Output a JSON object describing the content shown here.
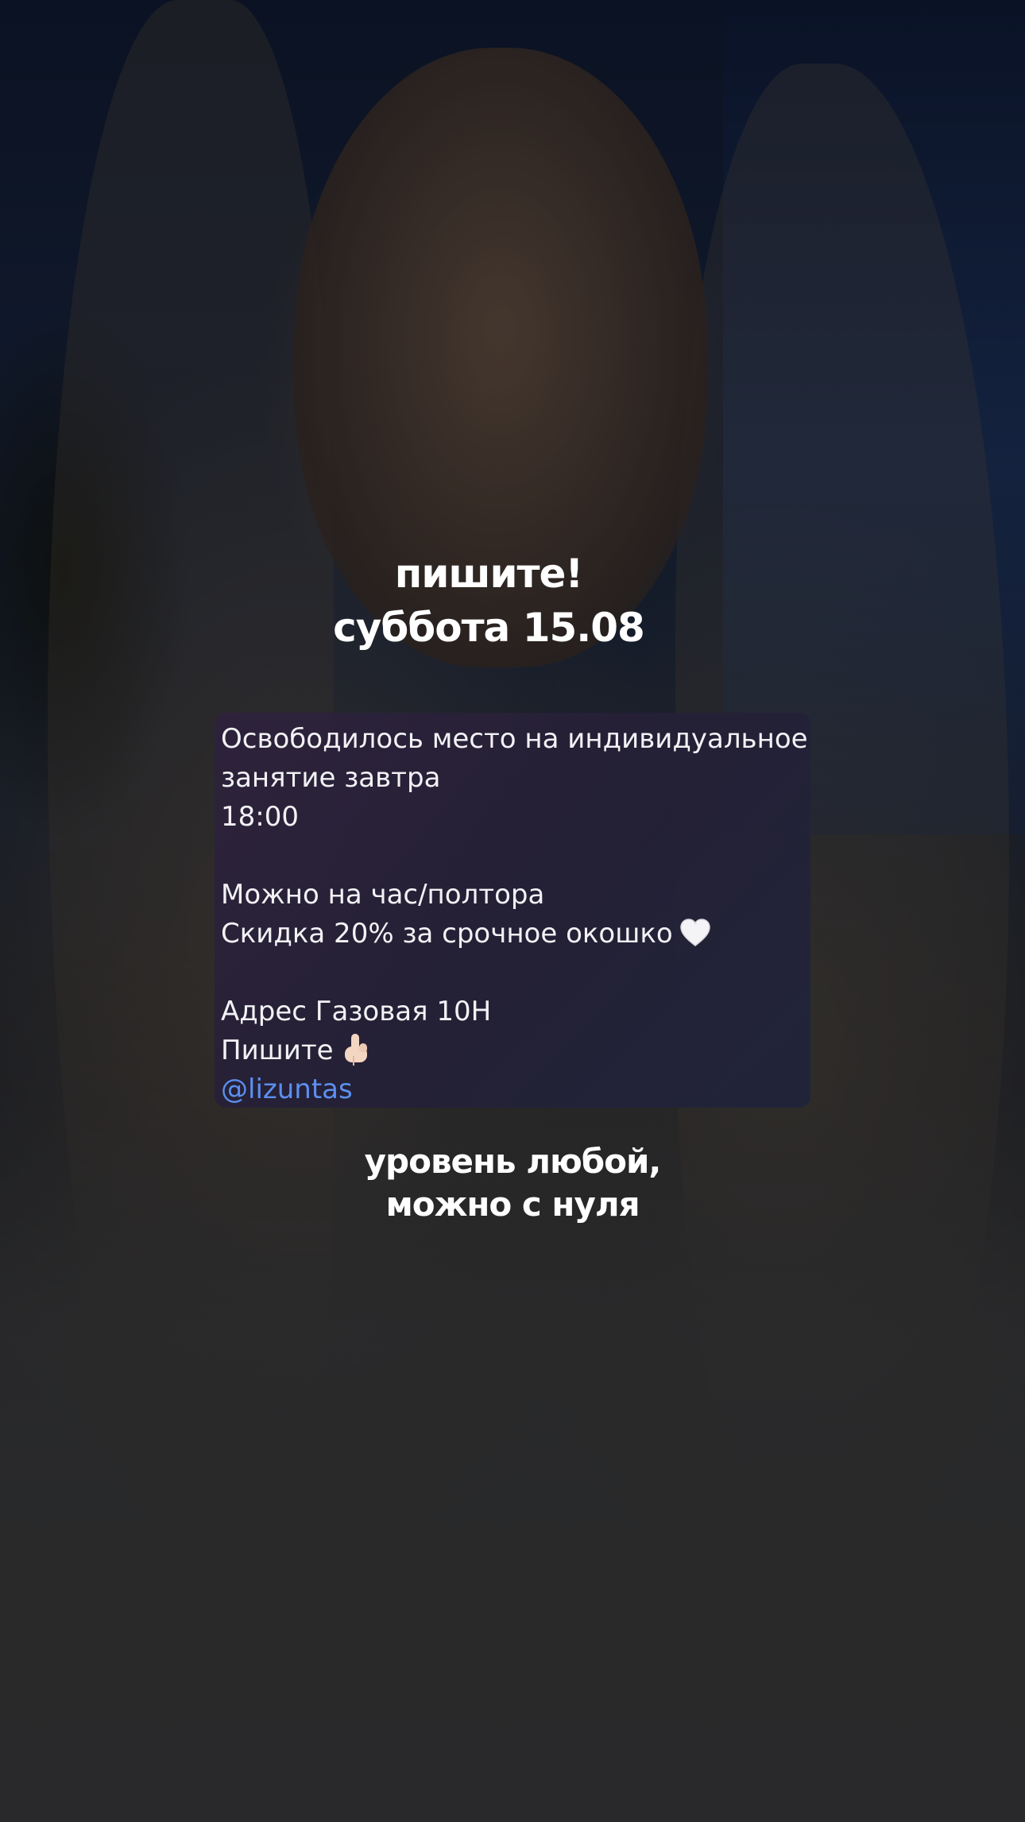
{
  "headline": {
    "line1": "пишите!",
    "line2": "суббота 15.08"
  },
  "message": {
    "line1": "Освободилось место на индивидуальное",
    "line2": "занятие завтра",
    "line3": "18:00",
    "line4": "Можно на час/полтора",
    "line5": "Скидка 20% за срочное окошко",
    "line6": "Адрес Газовая 10Н",
    "line7": "Пишите",
    "mention": "@lizuntas",
    "icons": [
      "white-heart-icon",
      "pointing-down-hand-icon"
    ],
    "colors": {
      "card": "#2a2438",
      "text": "#f2f2f5",
      "mention": "#5c8ff0"
    }
  },
  "footer": {
    "line1": "уровень любой,",
    "line2": "можно с нуля"
  }
}
